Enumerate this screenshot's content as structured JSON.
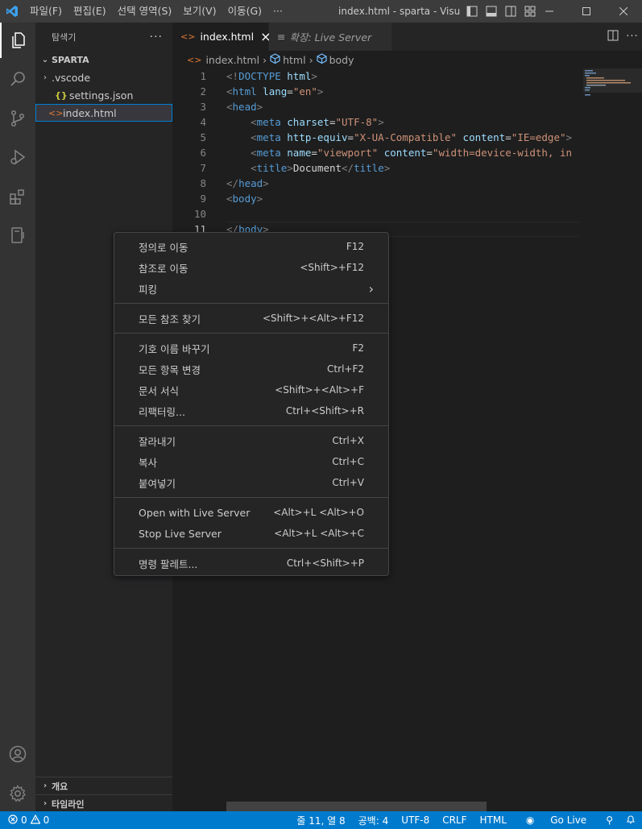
{
  "titlebar": {
    "menus": [
      "파일(F)",
      "편집(E)",
      "선택 영역(S)",
      "보기(V)",
      "이동(G)",
      "···"
    ],
    "title": "index.html - sparta - Visua..."
  },
  "sidebar": {
    "title": "탐색기",
    "more": "···",
    "workspace": "SPARTA",
    "tree": [
      {
        "label": ".vscode",
        "type": "folder"
      },
      {
        "label": "settings.json",
        "type": "json"
      },
      {
        "label": "index.html",
        "type": "html"
      }
    ],
    "bottom_sections": [
      "개요",
      "타임라인"
    ]
  },
  "tabs": [
    {
      "label": "index.html",
      "close": "×",
      "active": true
    },
    {
      "label": "확장: Live Server",
      "active": false
    }
  ],
  "breadcrumb": [
    "index.html",
    "html",
    "body"
  ],
  "code": {
    "current_line": 11,
    "lines": [
      [
        {
          "t": "brk",
          "v": "<!"
        },
        {
          "t": "tag",
          "v": "DOCTYPE"
        },
        {
          "t": "txt",
          "v": " "
        },
        {
          "t": "attr",
          "v": "html"
        },
        {
          "t": "brk",
          "v": ">"
        }
      ],
      [
        {
          "t": "brk",
          "v": "<"
        },
        {
          "t": "tag",
          "v": "html"
        },
        {
          "t": "txt",
          "v": " "
        },
        {
          "t": "attr",
          "v": "lang"
        },
        {
          "t": "txt",
          "v": "="
        },
        {
          "t": "str",
          "v": "\"en\""
        },
        {
          "t": "brk",
          "v": ">"
        }
      ],
      [
        {
          "t": "brk",
          "v": "<"
        },
        {
          "t": "tag",
          "v": "head"
        },
        {
          "t": "brk",
          "v": ">"
        }
      ],
      [
        {
          "t": "txt",
          "v": "    "
        },
        {
          "t": "brk",
          "v": "<"
        },
        {
          "t": "tag",
          "v": "meta"
        },
        {
          "t": "txt",
          "v": " "
        },
        {
          "t": "attr",
          "v": "charset"
        },
        {
          "t": "txt",
          "v": "="
        },
        {
          "t": "str",
          "v": "\"UTF-8\""
        },
        {
          "t": "brk",
          "v": ">"
        }
      ],
      [
        {
          "t": "txt",
          "v": "    "
        },
        {
          "t": "brk",
          "v": "<"
        },
        {
          "t": "tag",
          "v": "meta"
        },
        {
          "t": "txt",
          "v": " "
        },
        {
          "t": "attr",
          "v": "http-equiv"
        },
        {
          "t": "txt",
          "v": "="
        },
        {
          "t": "str",
          "v": "\"X-UA-Compatible\""
        },
        {
          "t": "txt",
          "v": " "
        },
        {
          "t": "attr",
          "v": "content"
        },
        {
          "t": "txt",
          "v": "="
        },
        {
          "t": "str",
          "v": "\"IE=edge\""
        },
        {
          "t": "brk",
          "v": ">"
        }
      ],
      [
        {
          "t": "txt",
          "v": "    "
        },
        {
          "t": "brk",
          "v": "<"
        },
        {
          "t": "tag",
          "v": "meta"
        },
        {
          "t": "txt",
          "v": " "
        },
        {
          "t": "attr",
          "v": "name"
        },
        {
          "t": "txt",
          "v": "="
        },
        {
          "t": "str",
          "v": "\"viewport\""
        },
        {
          "t": "txt",
          "v": " "
        },
        {
          "t": "attr",
          "v": "content"
        },
        {
          "t": "txt",
          "v": "="
        },
        {
          "t": "str",
          "v": "\"width=device-width, in"
        }
      ],
      [
        {
          "t": "txt",
          "v": "    "
        },
        {
          "t": "brk",
          "v": "<"
        },
        {
          "t": "tag",
          "v": "title"
        },
        {
          "t": "brk",
          "v": ">"
        },
        {
          "t": "txt",
          "v": "Document"
        },
        {
          "t": "brk",
          "v": "</"
        },
        {
          "t": "tag",
          "v": "title"
        },
        {
          "t": "brk",
          "v": ">"
        }
      ],
      [
        {
          "t": "brk",
          "v": "</"
        },
        {
          "t": "tag",
          "v": "head"
        },
        {
          "t": "brk",
          "v": ">"
        }
      ],
      [
        {
          "t": "brk",
          "v": "<"
        },
        {
          "t": "tag",
          "v": "body"
        },
        {
          "t": "brk",
          "v": ">"
        }
      ],
      [],
      [
        {
          "t": "brk",
          "v": "</"
        },
        {
          "t": "tag",
          "v": "body"
        },
        {
          "t": "brk",
          "v": ">"
        }
      ]
    ]
  },
  "context_menu": {
    "groups": [
      [
        {
          "label": "정의로 이동",
          "key": "F12"
        },
        {
          "label": "참조로 이동",
          "key": "<Shift>+F12"
        },
        {
          "label": "피킹",
          "key": "›"
        }
      ],
      [
        {
          "label": "모든 참조 찾기",
          "key": "<Shift>+<Alt>+F12"
        }
      ],
      [
        {
          "label": "기호 이름 바꾸기",
          "key": "F2"
        },
        {
          "label": "모든 항목 변경",
          "key": "Ctrl+F2"
        },
        {
          "label": "문서 서식",
          "key": "<Shift>+<Alt>+F"
        },
        {
          "label": "리팩터링...",
          "key": "Ctrl+<Shift>+R"
        }
      ],
      [
        {
          "label": "잘라내기",
          "key": "Ctrl+X"
        },
        {
          "label": "복사",
          "key": "Ctrl+C"
        },
        {
          "label": "붙여넣기",
          "key": "Ctrl+V"
        }
      ],
      [
        {
          "label": "Open with Live Server",
          "key": "<Alt>+L <Alt>+O"
        },
        {
          "label": "Stop Live Server",
          "key": "<Alt>+L <Alt>+C"
        }
      ],
      [
        {
          "label": "명령 팔레트...",
          "key": "Ctrl+<Shift>+P"
        }
      ]
    ]
  },
  "statusbar": {
    "errors": "0",
    "warnings": "0",
    "position": "줄 11, 열 8",
    "spaces": "공백: 4",
    "encoding": "UTF-8",
    "eol": "CRLF",
    "language": "HTML",
    "golive": "Go Live"
  },
  "colors": {
    "accent": "#007acc",
    "titlebar": "#3c3c3c",
    "activitybar": "#333333",
    "sidebar": "#252526",
    "editor": "#1e1e1e"
  }
}
